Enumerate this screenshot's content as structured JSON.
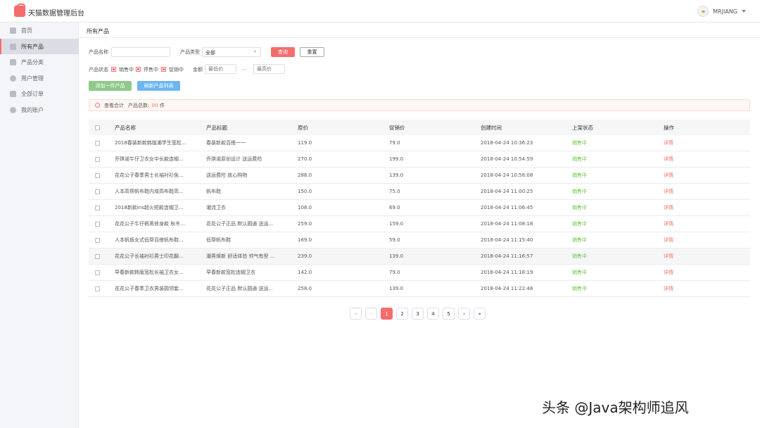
{
  "app": {
    "title": "天猫数据管理后台",
    "user": "MRJIANG"
  },
  "sidebar": {
    "items": [
      {
        "label": "首页"
      },
      {
        "label": "所有产品"
      },
      {
        "label": "产品分类"
      },
      {
        "label": "用户管理"
      },
      {
        "label": "全部订单"
      },
      {
        "label": "我的账户"
      }
    ]
  },
  "breadcrumb": "所有产品",
  "filters": {
    "name_label": "产品名称",
    "type_label": "产品类型",
    "type_value": "全部",
    "search_btn": "查询",
    "reset_btn": "重置",
    "status_label": "产品状态",
    "status_options": [
      "销售中",
      "停售中",
      "促销中"
    ],
    "amount_label": "金额",
    "min_placeholder": "最低价",
    "max_placeholder": "最高价",
    "dash": "—"
  },
  "actions": {
    "add": "添加一件产品",
    "refresh": "刷新产品列表"
  },
  "summary": {
    "text1": "查看合计",
    "text2": "产品总数:",
    "count": "00",
    "unit": "件"
  },
  "table": {
    "headers": [
      "产品名称",
      "产品标题",
      "原价",
      "促销价",
      "创建时间",
      "上架状态",
      "操作"
    ],
    "rows": [
      {
        "name": "2018春装新款韩版潮学生宽松...",
        "title": "春装新款百搭一一",
        "price": "119.0",
        "promo": "79.0",
        "time": "2018-04-24 10:36:23",
        "status": "销售中",
        "op": "详情"
      },
      {
        "name": "乔琪诺牛仔卫衣女中长款连帽...",
        "title": "乔琪诺原创设计 送运费险",
        "price": "270.0",
        "promo": "199.0",
        "time": "2018-04-24 10:54:59",
        "status": "销售中",
        "op": "详情"
      },
      {
        "name": "花花公子春季男士长袖衬衫免...",
        "title": "送运费险 放心购物",
        "price": "288.0",
        "promo": "139.0",
        "time": "2018-04-24 10:58:08",
        "status": "销售中",
        "op": "详情"
      },
      {
        "name": "人本高帮帆布鞋内增高布鞋高...",
        "title": "帆布鞋",
        "price": "150.0",
        "promo": "75.0",
        "time": "2018-04-24 11:00:25",
        "status": "销售中",
        "op": "详情"
      },
      {
        "name": "2018新款ins超火短款连帽卫...",
        "title": "潮流卫衣",
        "price": "108.0",
        "promo": "69.0",
        "time": "2018-04-24 11:06:45",
        "status": "销售中",
        "op": "详情"
      },
      {
        "name": "花花公子牛仔裤男修身款 秋冬...",
        "title": "花花公子正品 默认圆通 送运...",
        "price": "259.0",
        "promo": "159.0",
        "time": "2018-04-24 11:08:18",
        "status": "销售中",
        "op": "详情"
      },
      {
        "name": "人本帆板女式低帮百搭帆布鞋...",
        "title": "低帮帆布鞋",
        "price": "169.0",
        "promo": "59.0",
        "time": "2018-04-24 11:15:40",
        "status": "销售中",
        "op": "详情"
      },
      {
        "name": "花花公子长袖衬衫男士印花翻...",
        "title": "潮男焕新 舒适体验 帅气有型 ...",
        "price": "239.0",
        "promo": "139.0",
        "time": "2018-04-24 11:16:57",
        "status": "销售中",
        "op": "详情"
      },
      {
        "name": "早春新款韩版宽松长袖卫衣女...",
        "title": "早春新款宽松连帽卫衣",
        "price": "142.0",
        "promo": "79.0",
        "time": "2018-04-24 11:18:19",
        "status": "销售中",
        "op": "详情"
      },
      {
        "name": "花花公子春季卫衣男装圆领套...",
        "title": "花花公子正品 默认圆通 送运...",
        "price": "258.0",
        "promo": "139.0",
        "time": "2018-04-24 11:22:48",
        "status": "销售中",
        "op": "详情"
      }
    ]
  },
  "pager": {
    "first": "«",
    "prev": "‹",
    "pages": [
      "1",
      "2",
      "3",
      "4",
      "5"
    ],
    "next": "›",
    "last": "»"
  },
  "watermark": "头条 @Java架构师追风",
  "colors": {
    "accent": "#f56c6c",
    "status": "#67c23a",
    "add": "#8fc98b",
    "refresh": "#6db6f2"
  }
}
